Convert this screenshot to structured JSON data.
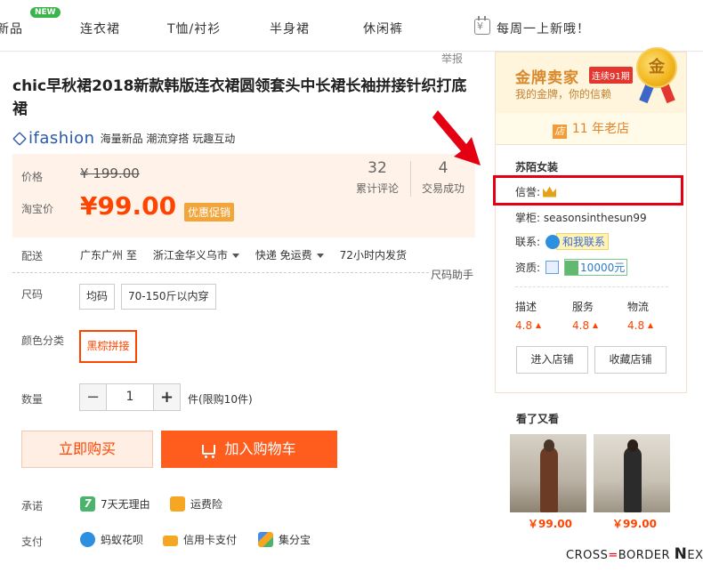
{
  "nav": {
    "new_badge": "NEW",
    "items": [
      "新品",
      "连衣裙",
      "T恤/衬衫",
      "半身裙",
      "休闲裤"
    ],
    "weekly": "每周一上新哦！"
  },
  "report": "举报",
  "product": {
    "title": "chic早秋裙2018新款韩版连衣裙圆领套头中长裙长袖拼接针织打底裙",
    "brand": "ifashion",
    "brand_slogan": "海量新品 潮流穿搭 玩趣互动"
  },
  "price": {
    "price_label": "价格",
    "original": "¥ 199.00",
    "taobao_label": "淘宝价",
    "current": "¥99.00",
    "promo": "优惠促销",
    "reviews_count": "32",
    "reviews_label": "累计评论",
    "sales_count": "4",
    "sales_label": "交易成功"
  },
  "shipping": {
    "label": "配送",
    "from": "广东广州 至",
    "to": "浙江金华义乌市",
    "method": "快递 免运费",
    "time": "72小时内发货"
  },
  "size_help": "尺码助手",
  "size": {
    "label": "尺码",
    "options": [
      "均码",
      "70-150斤以内穿"
    ]
  },
  "color": {
    "label": "颜色分类",
    "selected": "黑棕拼接"
  },
  "quantity": {
    "label": "数量",
    "minus": "−",
    "value": "1",
    "plus": "+",
    "note": "件(限购10件)"
  },
  "actions": {
    "buy": "立即购买",
    "cart": "加入购物车"
  },
  "promise": {
    "label": "承诺",
    "items": [
      "7天无理由",
      "运费险"
    ],
    "seven_glyph": "7"
  },
  "payment": {
    "label": "支付",
    "items": [
      "蚂蚁花呗",
      "信用卡支付",
      "集分宝"
    ]
  },
  "seller": {
    "gold_title": "金牌卖家",
    "gold_period": "连续91期",
    "gold_sub": "我的金牌，你的信赖",
    "medal_glyph": "金",
    "shop_icon_glyph": "店",
    "years": "11 年老店",
    "shop_name": "苏陌女装",
    "credit_label": "信誉:",
    "keeper_label": "掌柜:",
    "keeper": "seasonsinthesun99",
    "contact_label": "联系:",
    "contact_btn": "和我联系",
    "qual_label": "资质:",
    "deposit": "10000元",
    "scores": [
      {
        "name": "描述",
        "value": "4.8"
      },
      {
        "name": "服务",
        "value": "4.8"
      },
      {
        "name": "物流",
        "value": "4.8"
      }
    ],
    "enter_shop": "进入店铺",
    "fav_shop": "收藏店铺"
  },
  "also_viewed": {
    "title": "看了又看",
    "items": [
      {
        "price": "￥99.00"
      },
      {
        "price": "￥99.00"
      }
    ]
  },
  "watermark": {
    "left": "CROSS",
    "sep": "=",
    "mid": "BORDER",
    "big": "N",
    "rest": "EXT"
  },
  "colors": {
    "accent": "#ff4400",
    "cart_button": "#ff5d1e",
    "gold": "#d9882b",
    "highlight_box": "#e40012"
  }
}
